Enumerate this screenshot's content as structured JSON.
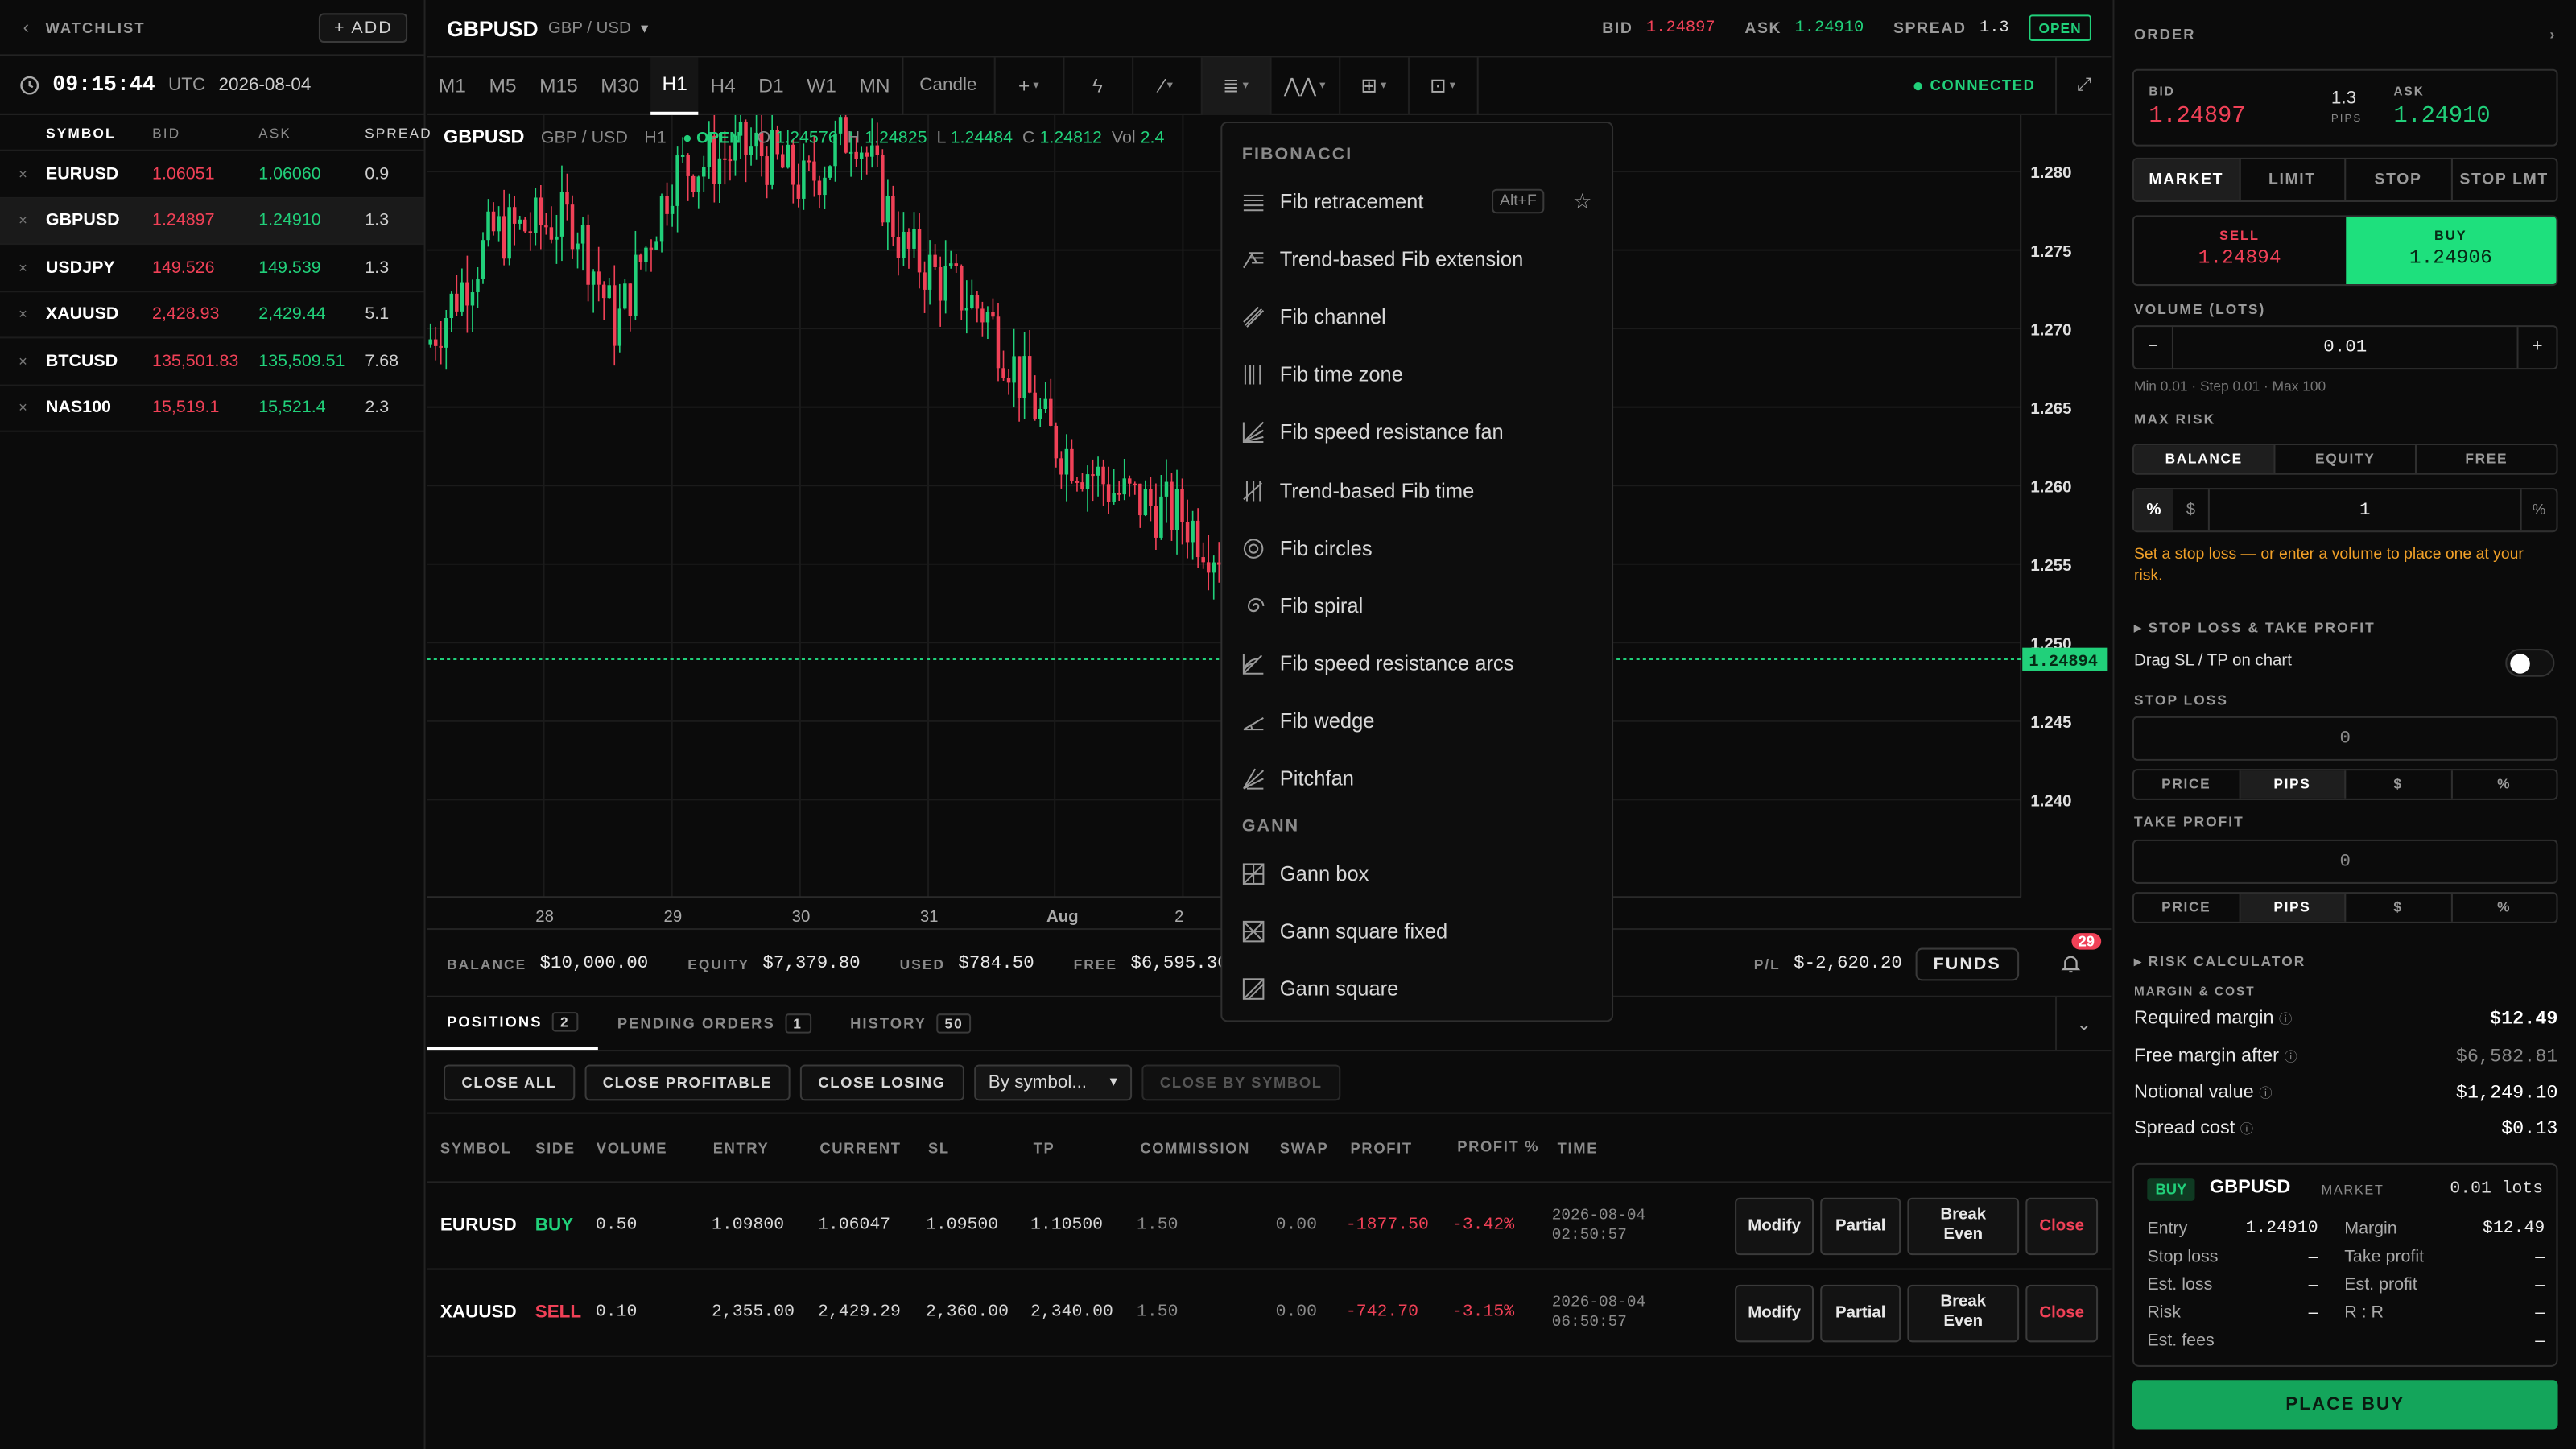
{
  "watchlist": {
    "title": "WATCHLIST",
    "add_label": "+ ADD",
    "time": "09:15:44",
    "tz": "UTC",
    "date": "2026-08-04",
    "headers": [
      "SYMBOL",
      "BID",
      "ASK",
      "SPREAD"
    ],
    "rows": [
      {
        "symbol": "EURUSD",
        "bid": "1.06051",
        "ask": "1.06060",
        "spread": "0.9"
      },
      {
        "symbol": "GBPUSD",
        "bid": "1.24897",
        "ask": "1.24910",
        "spread": "1.3"
      },
      {
        "symbol": "USDJPY",
        "bid": "149.526",
        "ask": "149.539",
        "spread": "1.3"
      },
      {
        "symbol": "XAUUSD",
        "bid": "2,428.93",
        "ask": "2,429.44",
        "spread": "5.1"
      },
      {
        "symbol": "BTCUSD",
        "bid": "135,501.83",
        "ask": "135,509.51",
        "spread": "7.68"
      },
      {
        "symbol": "NAS100",
        "bid": "15,519.1",
        "ask": "15,521.4",
        "spread": "2.3"
      }
    ]
  },
  "header": {
    "symbol": "GBPUSD",
    "pair": "GBP / USD",
    "bid_label": "BID",
    "bid": "1.24897",
    "ask_label": "ASK",
    "ask": "1.24910",
    "spread_label": "SPREAD",
    "spread": "1.3",
    "status": "OPEN"
  },
  "toolbar": {
    "timeframes": [
      "M1",
      "M5",
      "M15",
      "M30",
      "H1",
      "H4",
      "D1",
      "W1",
      "MN"
    ],
    "active": "H1",
    "chart_type": "Candle",
    "connection": "CONNECTED"
  },
  "chart": {
    "symbol": "GBPUSD",
    "pair": "GBP / USD",
    "tf": "H1",
    "status": "OPEN",
    "o_label": "O",
    "o": "1.24576",
    "h_label": "H",
    "h": "1.24825",
    "l_label": "L",
    "l": "1.24484",
    "c_label": "C",
    "c": "1.24812",
    "vol_label": "Vol",
    "vol": "2.4",
    "price_labels": [
      "1.280",
      "1.275",
      "1.270",
      "1.265",
      "1.260",
      "1.255",
      "1.250",
      "1.245",
      "1.240"
    ],
    "current_price": "1.24894",
    "date_labels": [
      "28",
      "29",
      "30",
      "31",
      "Aug",
      "2"
    ],
    "colors": {
      "up": "#21d07a",
      "down": "#f04157"
    }
  },
  "fib_menu": {
    "section1": "FIBONACCI",
    "items1": [
      {
        "label": "Fib retracement",
        "icon": "fib-retracement-icon",
        "shortcut": "Alt+F"
      },
      {
        "label": "Trend-based Fib extension",
        "icon": "fib-extension-icon"
      },
      {
        "label": "Fib channel",
        "icon": "fib-channel-icon"
      },
      {
        "label": "Fib time zone",
        "icon": "fib-time-zone-icon"
      },
      {
        "label": "Fib speed resistance fan",
        "icon": "fib-fan-icon"
      },
      {
        "label": "Trend-based Fib time",
        "icon": "fib-time-icon"
      },
      {
        "label": "Fib circles",
        "icon": "fib-circles-icon"
      },
      {
        "label": "Fib spiral",
        "icon": "fib-spiral-icon"
      },
      {
        "label": "Fib speed resistance arcs",
        "icon": "fib-arcs-icon"
      },
      {
        "label": "Fib wedge",
        "icon": "fib-wedge-icon"
      },
      {
        "label": "Pitchfan",
        "icon": "pitchfan-icon"
      }
    ],
    "section2": "GANN",
    "items2": [
      {
        "label": "Gann box",
        "icon": "gann-box-icon"
      },
      {
        "label": "Gann square fixed",
        "icon": "gann-square-fixed-icon"
      },
      {
        "label": "Gann square",
        "icon": "gann-square-icon"
      }
    ]
  },
  "account": {
    "balance_label": "BALANCE",
    "balance": "$10,000.00",
    "equity_label": "EQUITY",
    "equity": "$7,379.80",
    "used_label": "USED",
    "used": "$784.50",
    "free_label": "FREE",
    "free": "$6,595.30",
    "pl_label": "P/L",
    "pl": "$-2,620.20",
    "funds_label": "FUNDS",
    "notifications": "29"
  },
  "tabs": [
    {
      "label": "POSITIONS",
      "count": "2"
    },
    {
      "label": "PENDING ORDERS",
      "count": "1"
    },
    {
      "label": "HISTORY",
      "count": "50"
    }
  ],
  "actions": {
    "close_all": "CLOSE ALL",
    "close_profitable": "CLOSE PROFITABLE",
    "close_losing": "CLOSE LOSING",
    "by_symbol": "By symbol...",
    "close_by_symbol": "CLOSE BY SYMBOL"
  },
  "positions": {
    "headers": [
      "SYMBOL",
      "SIDE",
      "VOLUME",
      "ENTRY",
      "CURRENT",
      "SL",
      "TP",
      "COMMISSION",
      "SWAP",
      "PROFIT",
      "PROFIT %",
      "TIME"
    ],
    "rows": [
      {
        "symbol": "EURUSD",
        "side": "BUY",
        "volume": "0.50",
        "entry": "1.09800",
        "current": "1.06047",
        "sl": "1.09500",
        "tp": "1.10500",
        "commission": "1.50",
        "swap": "0.00",
        "profit": "-1877.50",
        "profit_pct": "-3.42%",
        "date": "2026-08-04",
        "time": "02:50:57"
      },
      {
        "symbol": "XAUUSD",
        "side": "SELL",
        "volume": "0.10",
        "entry": "2,355.00",
        "current": "2,429.29",
        "sl": "2,360.00",
        "tp": "2,340.00",
        "commission": "1.50",
        "swap": "0.00",
        "profit": "-742.70",
        "profit_pct": "-3.15%",
        "date": "2026-08-04",
        "time": "06:50:57"
      }
    ],
    "row_buttons": {
      "modify": "Modify",
      "partial": "Partial",
      "break_even": "Break Even",
      "close": "Close"
    }
  },
  "order": {
    "title": "ORDER",
    "bid_label": "BID",
    "bid": "1.24897",
    "pips": "1.3",
    "pips_label": "PIPS",
    "ask_label": "ASK",
    "ask": "1.24910",
    "types": [
      "MARKET",
      "LIMIT",
      "STOP",
      "STOP LMT"
    ],
    "sell_label": "SELL",
    "sell": "1.24894",
    "buy_label": "BUY",
    "buy": "1.24906",
    "volume_label": "VOLUME (LOTS)",
    "volume": "0.01",
    "volume_hint": "Min 0.01 · Step 0.01 · Max 100",
    "max_risk_label": "MAX RISK",
    "risk_bases": [
      "BALANCE",
      "EQUITY",
      "FREE"
    ],
    "risk_value": "1",
    "risk_warning": "Set a stop loss — or enter a volume to place one at your risk.",
    "sltp_label": "STOP LOSS & TAKE PROFIT",
    "drag_label": "Drag SL / TP on chart",
    "sl_label": "STOP LOSS",
    "sl_value": "0",
    "tp_label": "TAKE PROFIT",
    "tp_value": "0",
    "units": [
      "PRICE",
      "PIPS",
      "$",
      "%"
    ],
    "risk_calc_label": "RISK CALCULATOR",
    "margin_cost_label": "MARGIN & COST",
    "required_margin_label": "Required margin",
    "required_margin": "$12.49",
    "free_margin_label": "Free margin after",
    "free_margin": "$6,582.81",
    "notional_label": "Notional value",
    "notional": "$1,249.10",
    "spread_cost_label": "Spread cost",
    "spread_cost": "$0.13",
    "summary": {
      "side": "BUY",
      "symbol": "GBPUSD",
      "type": "MARKET",
      "lots": "0.01 lots",
      "entry_label": "Entry",
      "entry": "1.24910",
      "margin_label": "Margin",
      "margin": "$12.49",
      "sl_label": "Stop loss",
      "sl": "–",
      "tp_label": "Take profit",
      "tp": "–",
      "est_loss_label": "Est. loss",
      "est_loss": "–",
      "est_profit_label": "Est. profit",
      "est_profit": "–",
      "risk_label": "Risk",
      "risk": "–",
      "rr_label": "R : R",
      "rr": "–",
      "fees_label": "Est. fees",
      "fees": "–"
    },
    "place_label": "PLACE BUY"
  }
}
